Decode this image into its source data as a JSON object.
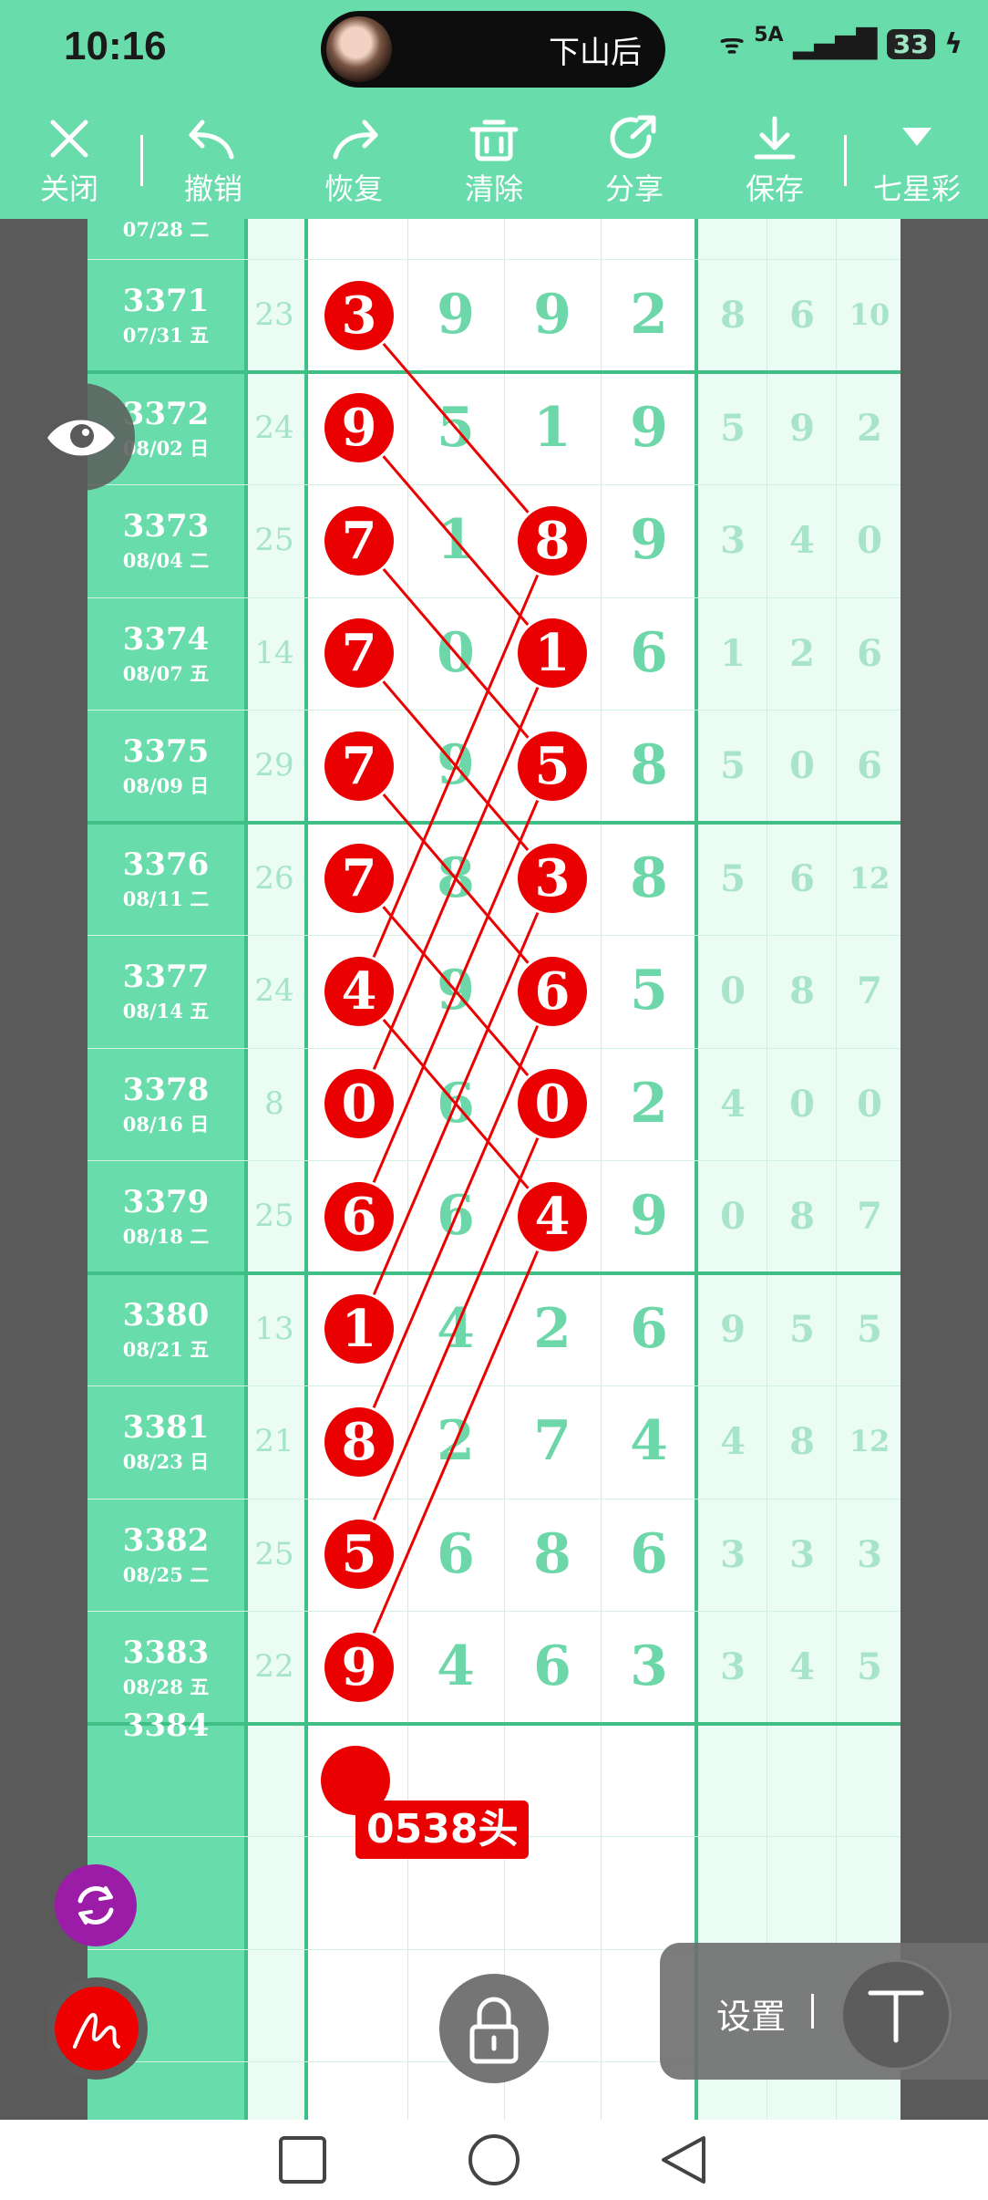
{
  "status_bar": {
    "time": "10:16",
    "island_text": "下山后",
    "network": "5A",
    "battery": "33"
  },
  "toolbar": [
    {
      "id": "close",
      "label": "关闭",
      "icon": "close-icon"
    },
    {
      "id": "undo",
      "label": "撤销",
      "icon": "undo-icon"
    },
    {
      "id": "redo",
      "label": "恢复",
      "icon": "redo-icon"
    },
    {
      "id": "clear",
      "label": "清除",
      "icon": "trash-icon"
    },
    {
      "id": "share",
      "label": "分享",
      "icon": "share-icon"
    },
    {
      "id": "save",
      "label": "保存",
      "icon": "download-icon"
    },
    {
      "id": "lottery",
      "label": "七星彩",
      "icon": "dropdown-triangle-icon"
    }
  ],
  "chart": {
    "top_row": {
      "issue": "07/28 二"
    },
    "rows": [
      {
        "issue": "3371",
        "date": "07/31 五",
        "sum": "23",
        "digits": [
          "3",
          "9",
          "9",
          "2"
        ],
        "extra": [
          "8",
          "6",
          "10"
        ]
      },
      {
        "issue": "3372",
        "date": "08/02 日",
        "sum": "24",
        "digits": [
          "9",
          "5",
          "1",
          "9"
        ],
        "extra": [
          "5",
          "9",
          "2"
        ]
      },
      {
        "issue": "3373",
        "date": "08/04 二",
        "sum": "25",
        "digits": [
          "7",
          "1",
          "8",
          "9"
        ],
        "extra": [
          "3",
          "4",
          "0"
        ]
      },
      {
        "issue": "3374",
        "date": "08/07 五",
        "sum": "14",
        "digits": [
          "7",
          "0",
          "1",
          "6"
        ],
        "extra": [
          "1",
          "2",
          "6"
        ]
      },
      {
        "issue": "3375",
        "date": "08/09 日",
        "sum": "29",
        "digits": [
          "7",
          "9",
          "5",
          "8"
        ],
        "extra": [
          "5",
          "0",
          "6"
        ]
      },
      {
        "issue": "3376",
        "date": "08/11 二",
        "sum": "26",
        "digits": [
          "7",
          "8",
          "3",
          "8"
        ],
        "extra": [
          "5",
          "6",
          "12"
        ]
      },
      {
        "issue": "3377",
        "date": "08/14 五",
        "sum": "24",
        "digits": [
          "4",
          "9",
          "6",
          "5"
        ],
        "extra": [
          "0",
          "8",
          "7"
        ]
      },
      {
        "issue": "3378",
        "date": "08/16 日",
        "sum": "8",
        "digits": [
          "0",
          "6",
          "0",
          "2"
        ],
        "extra": [
          "4",
          "0",
          "0"
        ]
      },
      {
        "issue": "3379",
        "date": "08/18 二",
        "sum": "25",
        "digits": [
          "6",
          "6",
          "4",
          "9"
        ],
        "extra": [
          "0",
          "8",
          "7"
        ]
      },
      {
        "issue": "3380",
        "date": "08/21 五",
        "sum": "13",
        "digits": [
          "1",
          "4",
          "2",
          "6"
        ],
        "extra": [
          "9",
          "5",
          "5"
        ]
      },
      {
        "issue": "3381",
        "date": "08/23 日",
        "sum": "21",
        "digits": [
          "8",
          "2",
          "7",
          "4"
        ],
        "extra": [
          "4",
          "8",
          "12"
        ]
      },
      {
        "issue": "3382",
        "date": "08/25 二",
        "sum": "25",
        "digits": [
          "5",
          "6",
          "8",
          "6"
        ],
        "extra": [
          "3",
          "3",
          "3"
        ]
      },
      {
        "issue": "3383",
        "date": "08/28 五",
        "sum": "22",
        "digits": [
          "9",
          "4",
          "6",
          "3"
        ],
        "extra": [
          "3",
          "4",
          "5"
        ]
      }
    ],
    "next_issue": "3384",
    "prediction_tag": "0538头",
    "marks_col1_rows": [
      0,
      1,
      2,
      3,
      4,
      5,
      6,
      7,
      8,
      9,
      10,
      11,
      12
    ],
    "marks_col3_rows": [
      2,
      3,
      4,
      5,
      6,
      7,
      8
    ],
    "colors": {
      "mark": "#ea0000",
      "theme": "#68dcaa",
      "digit": "#6ed7aa"
    }
  },
  "floating": {
    "settings_label": "设置"
  }
}
